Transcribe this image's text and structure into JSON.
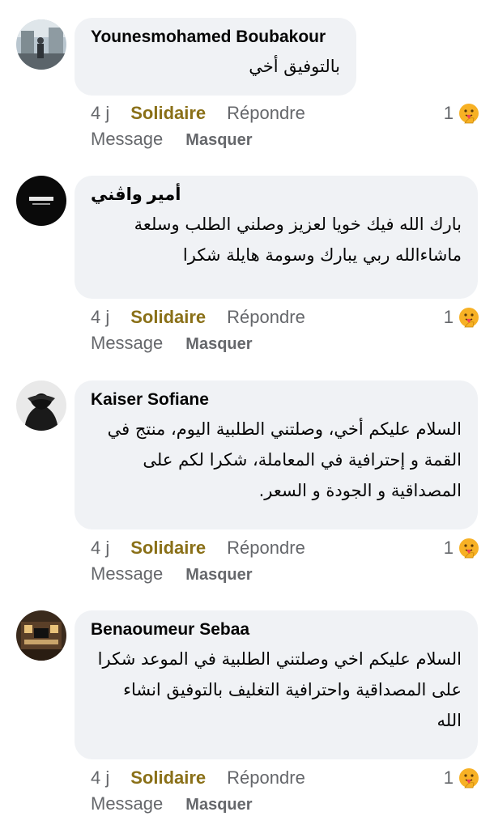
{
  "labels": {
    "reaction": "Solidaire",
    "reply": "Répondre",
    "message": "Message",
    "hide": "Masquer"
  },
  "comments": [
    {
      "author": "Younesmohamed Boubakour",
      "lines": [
        "بالتوفيق أخي"
      ],
      "time": "4 j",
      "reaction_count": "1",
      "avatar": "street-photo-avatar"
    },
    {
      "author": "أمير واڨني",
      "lines": [
        "بارك الله فيك خويا لعزيز وصلني الطلب وسلعة",
        "ماشاءالله ربي يبارك وسومة هايلة شكرا"
      ],
      "time": "4 j",
      "reaction_count": "1",
      "avatar": "black-logo-avatar"
    },
    {
      "author": "Kaiser Sofiane",
      "lines": [
        "السلام عليكم أخي، وصلتني الطلبية اليوم، منتج في",
        "القمة و إحترافية في المعاملة، شكرا لكم على",
        "المصداقية و الجودة و السعر."
      ],
      "time": "4 j",
      "reaction_count": "1",
      "avatar": "hooded-figure-avatar"
    },
    {
      "author": "Benaoumeur Sebaa",
      "lines": [
        "السلام عليكم اخي وصلتني الطلبية في الموعد شكرا",
        "على المصداقية واحترافية التغليف بالتوفيق انشاء",
        "الله"
      ],
      "time": "4 j",
      "reaction_count": "1",
      "avatar": "living-room-avatar"
    }
  ],
  "colors": {
    "bubble": "#f0f2f5",
    "reaction_gold": "#8a7018",
    "secondary_text": "#65676b",
    "primary_text": "#050505"
  }
}
